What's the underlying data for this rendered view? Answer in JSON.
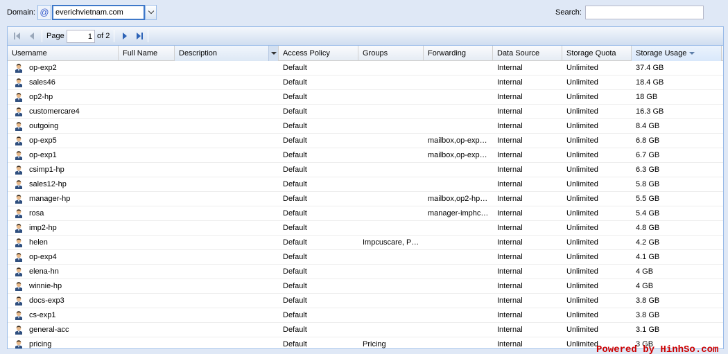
{
  "toolbar": {
    "domain_label": "Domain:",
    "domain_value": "everichvietnam.com",
    "search_label": "Search:",
    "search_value": ""
  },
  "pager": {
    "page_label": "Page",
    "page_value": "1",
    "of_label": "of 2"
  },
  "columns": {
    "username": "Username",
    "full_name": "Full Name",
    "description": "Description",
    "access_policy": "Access Policy",
    "groups": "Groups",
    "forwarding": "Forwarding",
    "data_source": "Data Source",
    "storage_quota": "Storage Quota",
    "storage_usage": "Storage Usage"
  },
  "rows": [
    {
      "username": "op-exp2",
      "full_name": "",
      "description": "",
      "access_policy": "Default",
      "groups": "",
      "forwarding": "",
      "data_source": "Internal",
      "storage_quota": "Unlimited",
      "storage_usage": "37.4 GB"
    },
    {
      "username": "sales46",
      "full_name": "",
      "description": "",
      "access_policy": "Default",
      "groups": "",
      "forwarding": "",
      "data_source": "Internal",
      "storage_quota": "Unlimited",
      "storage_usage": "18.4 GB"
    },
    {
      "username": "op2-hp",
      "full_name": "",
      "description": "",
      "access_policy": "Default",
      "groups": "",
      "forwarding": "",
      "data_source": "Internal",
      "storage_quota": "Unlimited",
      "storage_usage": "18 GB"
    },
    {
      "username": "customercare4",
      "full_name": "",
      "description": "",
      "access_policy": "Default",
      "groups": "",
      "forwarding": "",
      "data_source": "Internal",
      "storage_quota": "Unlimited",
      "storage_usage": "16.3 GB"
    },
    {
      "username": "outgoing",
      "full_name": "",
      "description": "",
      "access_policy": "Default",
      "groups": "",
      "forwarding": "",
      "data_source": "Internal",
      "storage_quota": "Unlimited",
      "storage_usage": "8.4 GB"
    },
    {
      "username": "op-exp5",
      "full_name": "",
      "description": "",
      "access_policy": "Default",
      "groups": "",
      "forwarding": "mailbox,op-exp…",
      "data_source": "Internal",
      "storage_quota": "Unlimited",
      "storage_usage": "6.8 GB"
    },
    {
      "username": "op-exp1",
      "full_name": "",
      "description": "",
      "access_policy": "Default",
      "groups": "",
      "forwarding": "mailbox,op-exp…",
      "data_source": "Internal",
      "storage_quota": "Unlimited",
      "storage_usage": "6.7 GB"
    },
    {
      "username": "csimp1-hp",
      "full_name": "",
      "description": "",
      "access_policy": "Default",
      "groups": "",
      "forwarding": "",
      "data_source": "Internal",
      "storage_quota": "Unlimited",
      "storage_usage": "6.3 GB"
    },
    {
      "username": "sales12-hp",
      "full_name": "",
      "description": "",
      "access_policy": "Default",
      "groups": "",
      "forwarding": "",
      "data_source": "Internal",
      "storage_quota": "Unlimited",
      "storage_usage": "5.8 GB"
    },
    {
      "username": "manager-hp",
      "full_name": "",
      "description": "",
      "access_policy": "Default",
      "groups": "",
      "forwarding": "mailbox,op2-hp…",
      "data_source": "Internal",
      "storage_quota": "Unlimited",
      "storage_usage": "5.5 GB"
    },
    {
      "username": "rosa",
      "full_name": "",
      "description": "",
      "access_policy": "Default",
      "groups": "",
      "forwarding": "manager-imphc…",
      "data_source": "Internal",
      "storage_quota": "Unlimited",
      "storage_usage": "5.4 GB"
    },
    {
      "username": "imp2-hp",
      "full_name": "",
      "description": "",
      "access_policy": "Default",
      "groups": "",
      "forwarding": "",
      "data_source": "Internal",
      "storage_quota": "Unlimited",
      "storage_usage": "4.8 GB"
    },
    {
      "username": "helen",
      "full_name": "",
      "description": "",
      "access_policy": "Default",
      "groups": "Impcuscare, P…",
      "forwarding": "",
      "data_source": "Internal",
      "storage_quota": "Unlimited",
      "storage_usage": "4.2 GB"
    },
    {
      "username": "op-exp4",
      "full_name": "",
      "description": "",
      "access_policy": "Default",
      "groups": "",
      "forwarding": "",
      "data_source": "Internal",
      "storage_quota": "Unlimited",
      "storage_usage": "4.1 GB"
    },
    {
      "username": "elena-hn",
      "full_name": "",
      "description": "",
      "access_policy": "Default",
      "groups": "",
      "forwarding": "",
      "data_source": "Internal",
      "storage_quota": "Unlimited",
      "storage_usage": "4 GB"
    },
    {
      "username": "winnie-hp",
      "full_name": "",
      "description": "",
      "access_policy": "Default",
      "groups": "",
      "forwarding": "",
      "data_source": "Internal",
      "storage_quota": "Unlimited",
      "storage_usage": "4 GB"
    },
    {
      "username": "docs-exp3",
      "full_name": "",
      "description": "",
      "access_policy": "Default",
      "groups": "",
      "forwarding": "",
      "data_source": "Internal",
      "storage_quota": "Unlimited",
      "storage_usage": "3.8 GB"
    },
    {
      "username": "cs-exp1",
      "full_name": "",
      "description": "",
      "access_policy": "Default",
      "groups": "",
      "forwarding": "",
      "data_source": "Internal",
      "storage_quota": "Unlimited",
      "storage_usage": "3.8 GB"
    },
    {
      "username": "general-acc",
      "full_name": "",
      "description": "",
      "access_policy": "Default",
      "groups": "",
      "forwarding": "",
      "data_source": "Internal",
      "storage_quota": "Unlimited",
      "storage_usage": "3.1 GB"
    },
    {
      "username": "pricing",
      "full_name": "",
      "description": "",
      "access_policy": "Default",
      "groups": "Pricing",
      "forwarding": "",
      "data_source": "Internal",
      "storage_quota": "Unlimited",
      "storage_usage": "3 GB"
    }
  ],
  "footer": {
    "powered_by": "Powered by HinhSo.com"
  },
  "colors": {
    "background": "#dfe8f6",
    "border": "#99bbe8",
    "powered_text": "#cc0000"
  }
}
